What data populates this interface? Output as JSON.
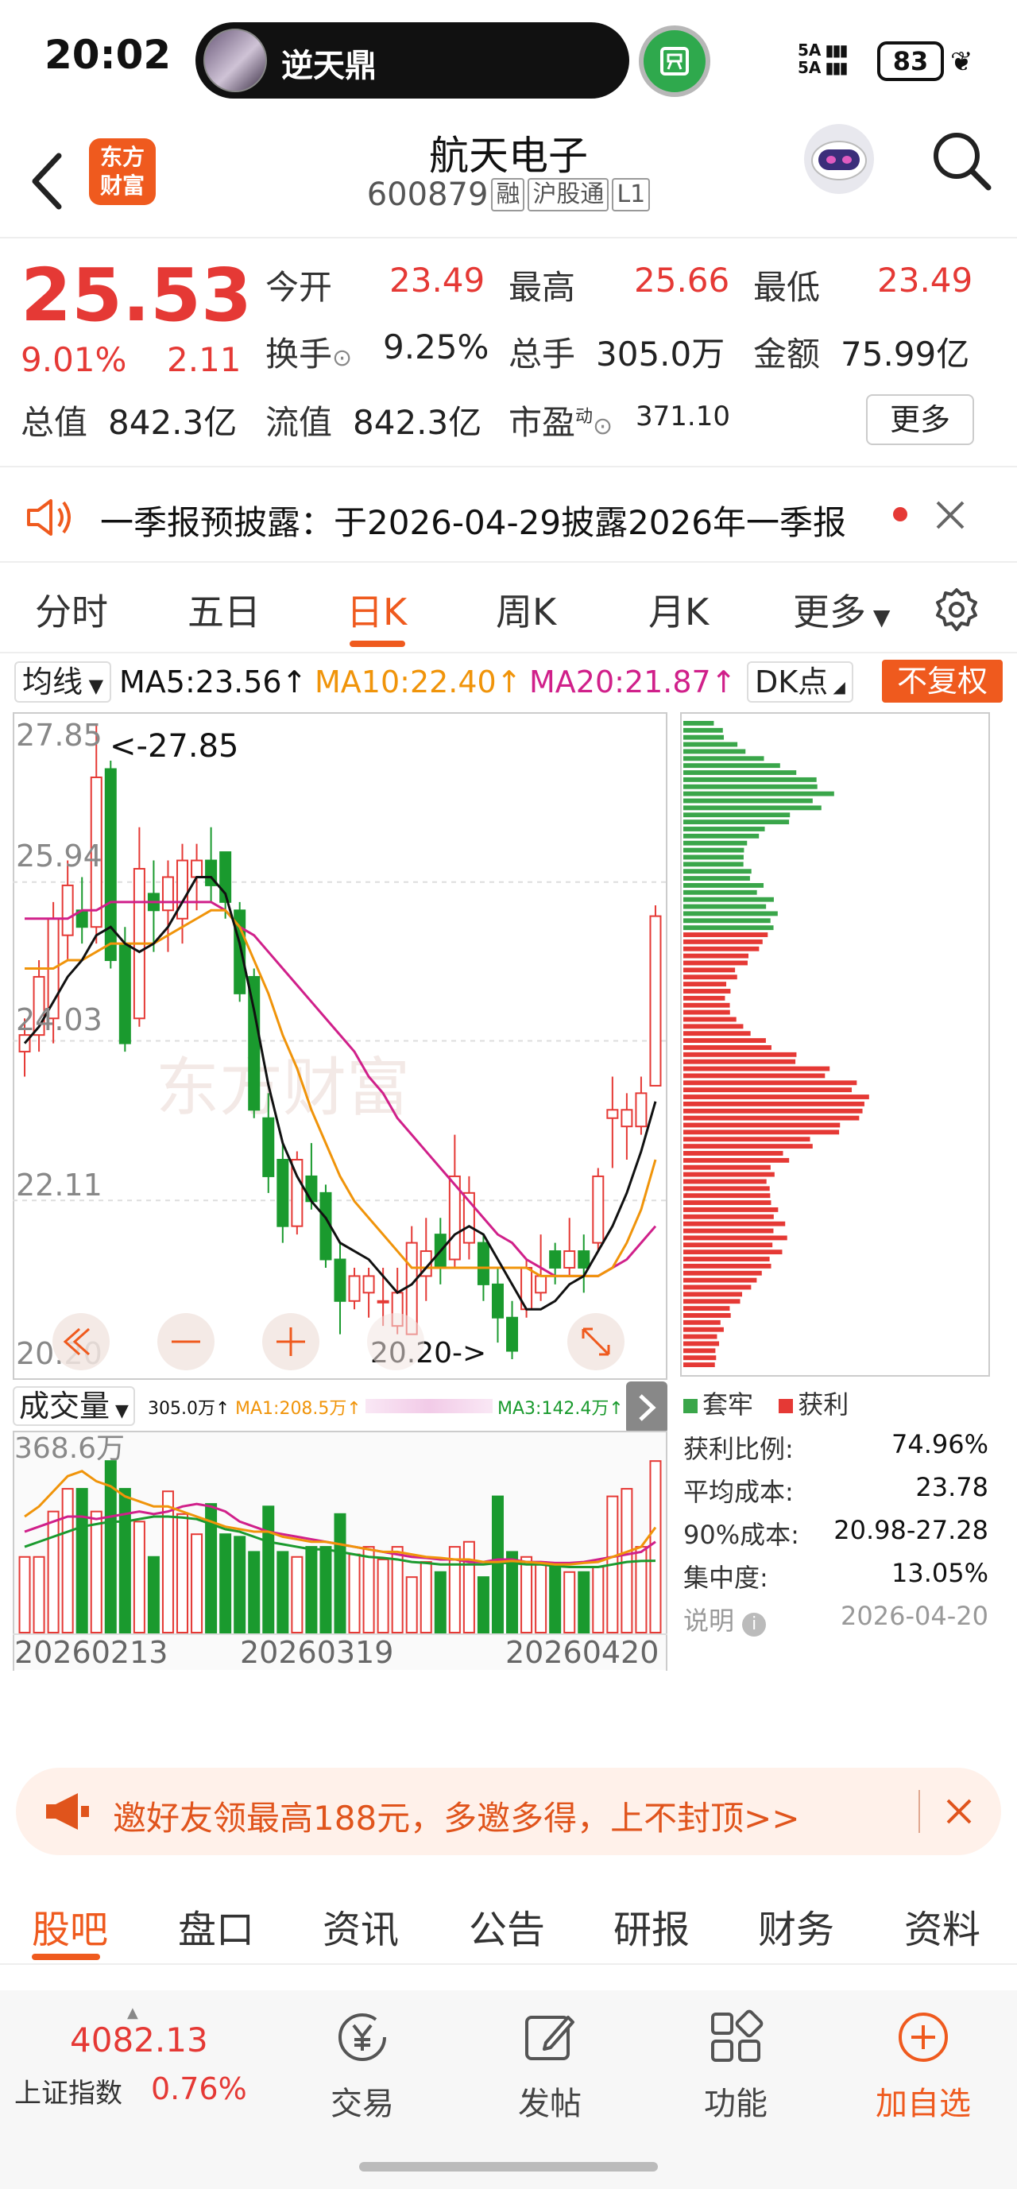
{
  "status_bar": {
    "time": "20:02",
    "now_playing": "逆天鼎",
    "signal_top": "5A",
    "signal_bottom": "5A",
    "battery": "83"
  },
  "header": {
    "logo_line1": "东方",
    "logo_line2": "财富",
    "stock_name": "航天电子",
    "stock_code": "600879",
    "tags": [
      "融",
      "沪股通",
      "L1"
    ]
  },
  "quote": {
    "price": "25.53",
    "change_pct": "9.01%",
    "change_abs": "2.11",
    "open_label": "今开",
    "open": "23.49",
    "high_label": "最高",
    "high": "25.66",
    "low_label": "最低",
    "low": "23.49",
    "turnover_label": "换手",
    "turnover": "9.25%",
    "volume_label": "总手",
    "volume": "305.0万",
    "amount_label": "金额",
    "amount": "75.99亿",
    "mktcap_label": "总值",
    "mktcap": "842.3亿",
    "float_label": "流值",
    "float_cap": "842.3亿",
    "pe_label": "市盈",
    "pe_sup": "动",
    "pe": "371.10",
    "more": "更多",
    "colors": {
      "up": "#e53935",
      "down": "#1a9a2e",
      "accent": "#ef5a1e"
    }
  },
  "notice": {
    "text": "一季报预披露：于2026-04-29披露2026年一季报"
  },
  "tabs": [
    "分时",
    "五日",
    "日K",
    "周K",
    "月K",
    "更多"
  ],
  "active_tab": "日K",
  "ma_row": {
    "selector": "均线",
    "ma5": "MA5:23.56↑",
    "ma10": "MA10:22.40↑",
    "ma20": "MA20:21.87↑",
    "dk": "DK点",
    "fuquan": "不复权",
    "colors": {
      "ma5": "#111111",
      "ma10": "#f0940a",
      "ma20": "#d0208a"
    }
  },
  "kchart_labels": {
    "y_ticks": [
      "27.85",
      "25.94",
      "24.03",
      "22.11",
      "20.20"
    ],
    "high_marker": "<-27.85",
    "low_marker": "20.20->",
    "watermark": "东方财富"
  },
  "chart_data": [
    {
      "type": "candlestick",
      "ylim": [
        20.2,
        27.85
      ],
      "y_ticks": [
        27.85,
        25.94,
        24.03,
        22.11,
        20.2
      ],
      "x_ticks": [
        "20260213",
        "20260319",
        "20260420"
      ],
      "candles": [
        {
          "o": 23.9,
          "h": 24.3,
          "l": 23.6,
          "c": 24.1
        },
        {
          "o": 24.1,
          "h": 25.0,
          "l": 23.9,
          "c": 24.8
        },
        {
          "o": 24.3,
          "h": 25.7,
          "l": 24.0,
          "c": 25.5
        },
        {
          "o": 25.3,
          "h": 26.2,
          "l": 25.0,
          "c": 25.9
        },
        {
          "o": 25.6,
          "h": 26.0,
          "l": 25.2,
          "c": 25.4
        },
        {
          "o": 25.4,
          "h": 27.85,
          "l": 25.2,
          "c": 27.2
        },
        {
          "o": 27.3,
          "h": 27.4,
          "l": 24.9,
          "c": 25.0
        },
        {
          "o": 25.2,
          "h": 25.4,
          "l": 23.9,
          "c": 24.0
        },
        {
          "o": 24.3,
          "h": 26.6,
          "l": 24.2,
          "c": 26.1
        },
        {
          "o": 25.8,
          "h": 26.2,
          "l": 25.1,
          "c": 25.6
        },
        {
          "o": 25.6,
          "h": 26.2,
          "l": 25.1,
          "c": 26.0
        },
        {
          "o": 25.5,
          "h": 26.4,
          "l": 25.2,
          "c": 26.2
        },
        {
          "o": 26.0,
          "h": 26.4,
          "l": 25.6,
          "c": 26.2
        },
        {
          "o": 26.2,
          "h": 26.6,
          "l": 25.7,
          "c": 25.9
        },
        {
          "o": 26.3,
          "h": 26.3,
          "l": 25.5,
          "c": 25.7
        },
        {
          "o": 25.6,
          "h": 25.7,
          "l": 24.5,
          "c": 24.6
        },
        {
          "o": 24.8,
          "h": 24.9,
          "l": 23.1,
          "c": 23.2
        },
        {
          "o": 23.1,
          "h": 23.4,
          "l": 22.2,
          "c": 22.4
        },
        {
          "o": 22.6,
          "h": 22.8,
          "l": 21.6,
          "c": 21.8
        },
        {
          "o": 21.8,
          "h": 22.7,
          "l": 21.7,
          "c": 22.6
        },
        {
          "o": 22.4,
          "h": 22.8,
          "l": 22.0,
          "c": 22.1
        },
        {
          "o": 22.2,
          "h": 22.3,
          "l": 21.3,
          "c": 21.4
        },
        {
          "o": 21.4,
          "h": 21.6,
          "l": 20.5,
          "c": 20.9
        },
        {
          "o": 20.9,
          "h": 21.3,
          "l": 20.8,
          "c": 21.2
        },
        {
          "o": 21.0,
          "h": 21.3,
          "l": 20.7,
          "c": 21.2
        },
        {
          "o": 20.9,
          "h": 21.3,
          "l": 20.6,
          "c": 20.9
        },
        {
          "o": 20.6,
          "h": 21.3,
          "l": 20.5,
          "c": 21.0
        },
        {
          "o": 20.5,
          "h": 21.8,
          "l": 20.5,
          "c": 21.6
        },
        {
          "o": 21.2,
          "h": 21.9,
          "l": 20.9,
          "c": 21.5
        },
        {
          "o": 21.7,
          "h": 21.9,
          "l": 21.1,
          "c": 21.3
        },
        {
          "o": 21.4,
          "h": 22.9,
          "l": 21.3,
          "c": 22.4
        },
        {
          "o": 21.6,
          "h": 22.4,
          "l": 21.4,
          "c": 22.2
        },
        {
          "o": 21.6,
          "h": 21.7,
          "l": 20.9,
          "c": 21.1
        },
        {
          "o": 21.1,
          "h": 21.3,
          "l": 20.4,
          "c": 20.7
        },
        {
          "o": 20.7,
          "h": 20.9,
          "l": 20.2,
          "c": 20.3
        },
        {
          "o": 20.8,
          "h": 21.4,
          "l": 20.7,
          "c": 21.3
        },
        {
          "o": 21.0,
          "h": 21.7,
          "l": 20.9,
          "c": 21.2
        },
        {
          "o": 21.5,
          "h": 21.6,
          "l": 21.1,
          "c": 21.3
        },
        {
          "o": 21.3,
          "h": 21.9,
          "l": 21.2,
          "c": 21.5
        },
        {
          "o": 21.5,
          "h": 21.7,
          "l": 21.0,
          "c": 21.3
        },
        {
          "o": 21.6,
          "h": 22.5,
          "l": 21.5,
          "c": 22.4
        },
        {
          "o": 23.1,
          "h": 23.6,
          "l": 22.5,
          "c": 23.2
        },
        {
          "o": 23.0,
          "h": 23.4,
          "l": 22.6,
          "c": 23.2
        },
        {
          "o": 23.0,
          "h": 23.6,
          "l": 22.9,
          "c": 23.4
        },
        {
          "o": 23.49,
          "h": 25.66,
          "l": 23.49,
          "c": 25.53
        }
      ],
      "ma5": [
        24.0,
        24.2,
        24.5,
        24.8,
        25.0,
        25.3,
        25.4,
        25.2,
        25.1,
        25.2,
        25.4,
        25.7,
        26.0,
        26.0,
        25.8,
        25.2,
        24.4,
        23.5,
        22.8,
        22.4,
        22.1,
        21.9,
        21.6,
        21.5,
        21.4,
        21.2,
        21.0,
        21.1,
        21.3,
        21.5,
        21.7,
        21.8,
        21.7,
        21.4,
        21.1,
        20.8,
        20.8,
        20.9,
        21.1,
        21.2,
        21.5,
        21.8,
        22.2,
        22.7,
        23.3
      ],
      "ma10": [
        24.9,
        24.9,
        24.9,
        25.0,
        25.0,
        25.1,
        25.2,
        25.2,
        25.2,
        25.2,
        25.3,
        25.4,
        25.5,
        25.6,
        25.6,
        25.4,
        25.0,
        24.6,
        24.1,
        23.7,
        23.2,
        22.8,
        22.4,
        22.1,
        21.9,
        21.7,
        21.5,
        21.3,
        21.3,
        21.3,
        21.3,
        21.3,
        21.3,
        21.3,
        21.3,
        21.3,
        21.2,
        21.2,
        21.2,
        21.2,
        21.2,
        21.3,
        21.6,
        22.0,
        22.6
      ],
      "ma20": [
        25.5,
        25.5,
        25.5,
        25.5,
        25.6,
        25.6,
        25.7,
        25.7,
        25.7,
        25.7,
        25.7,
        25.7,
        25.7,
        25.7,
        25.6,
        25.4,
        25.3,
        25.1,
        24.9,
        24.7,
        24.5,
        24.3,
        24.1,
        23.9,
        23.6,
        23.4,
        23.1,
        22.9,
        22.7,
        22.5,
        22.3,
        22.1,
        21.9,
        21.7,
        21.6,
        21.4,
        21.3,
        21.2,
        21.2,
        21.2,
        21.2,
        21.3,
        21.4,
        21.6,
        21.8
      ]
    },
    {
      "type": "bar",
      "title": "成交量",
      "ylim": [
        0,
        368.6
      ],
      "values": [
        150,
        150,
        240,
        285,
        285,
        240,
        340,
        285,
        220,
        150,
        280,
        235,
        195,
        255,
        195,
        190,
        160,
        250,
        160,
        150,
        170,
        170,
        235,
        155,
        170,
        145,
        170,
        110,
        140,
        120,
        170,
        180,
        110,
        270,
        160,
        150,
        140,
        130,
        120,
        120,
        130,
        270,
        285,
        170,
        340
      ],
      "ma1": [
        230,
        250,
        280,
        310,
        320,
        300,
        290,
        270,
        260,
        250,
        250,
        240,
        230,
        220,
        210,
        205,
        200,
        200,
        190,
        185,
        180,
        180,
        175,
        170,
        165,
        160,
        160,
        155,
        150,
        148,
        145,
        145,
        140,
        140,
        142,
        140,
        138,
        135,
        135,
        138,
        140,
        150,
        160,
        170,
        208.5
      ],
      "ma2": [
        200,
        210,
        220,
        230,
        230,
        225,
        230,
        235,
        240,
        235,
        240,
        250,
        255,
        250,
        240,
        220,
        210,
        200,
        195,
        190,
        185,
        180,
        175,
        170,
        165,
        160,
        155,
        150,
        148,
        145,
        145,
        140,
        140,
        145,
        145,
        140,
        140,
        138,
        138,
        140,
        145,
        150,
        155,
        160,
        180
      ],
      "ma3": [
        170,
        180,
        190,
        200,
        210,
        215,
        220,
        220,
        225,
        230,
        230,
        228,
        225,
        215,
        205,
        200,
        190,
        180,
        175,
        170,
        165,
        165,
        160,
        155,
        150,
        148,
        145,
        140,
        138,
        135,
        135,
        135,
        135,
        138,
        138,
        135,
        135,
        132,
        130,
        130,
        130,
        135,
        140,
        142,
        142.4
      ]
    },
    {
      "type": "bar",
      "orientation": "horizontal",
      "title": "筹码分布",
      "bins": 92,
      "trapped_bins": 30,
      "legend": [
        "套牢",
        "获利"
      ]
    }
  ],
  "volume_row": {
    "selector": "成交量",
    "vol": "305.0万↑",
    "ma1": "MA1:208.5万↑",
    "ma3": "MA3:142.4万↑",
    "y_max_label": "368.6万",
    "colors": {
      "ma1": "#f0940a",
      "ma2": "#d0208a",
      "ma3": "#1a9a2e"
    }
  },
  "distribution": {
    "legend_trapped": "套牢",
    "legend_profit": "获利",
    "profit_ratio_label": "获利比例:",
    "profit_ratio": "74.96%",
    "avg_cost_label": "平均成本:",
    "avg_cost": "23.78",
    "cost90_label": "90%成本:",
    "cost90": "20.98-27.28",
    "concentration_label": "集中度:",
    "concentration": "13.05%",
    "note_label": "说明",
    "date": "2026-04-20"
  },
  "promo": {
    "text": "邀好友领最高188元，多邀多得，上不封顶>>"
  },
  "sub_tabs": [
    "股吧",
    "盘口",
    "资讯",
    "公告",
    "研报",
    "财务",
    "资料"
  ],
  "active_sub_tab": "股吧",
  "bottom_bar": {
    "index_value": "4082.13",
    "index_name": "上证指数",
    "index_pct": "0.76%",
    "items": [
      {
        "label": "交易",
        "icon": "yen-icon"
      },
      {
        "label": "发帖",
        "icon": "edit-icon"
      },
      {
        "label": "功能",
        "icon": "grid-icon"
      },
      {
        "label": "加自选",
        "icon": "plus-circle-icon"
      }
    ]
  }
}
